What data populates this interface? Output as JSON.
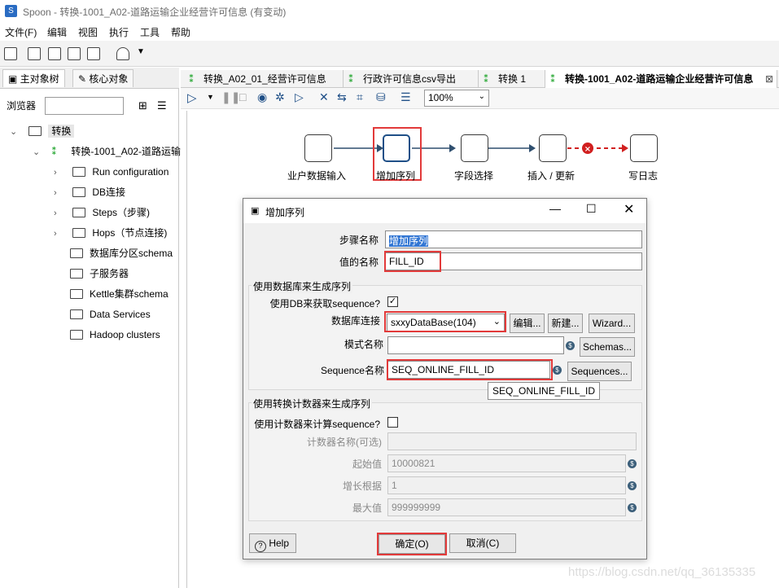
{
  "window": {
    "title": "Spoon - 转换-1001_A02-道路运输企业经营许可信息 (有变动)",
    "logo": "S"
  },
  "menu": [
    "文件(F)",
    "编辑",
    "视图",
    "执行",
    "工具",
    "帮助"
  ],
  "left_panel": {
    "tabs": [
      "主对象树",
      "核心对象"
    ],
    "browse_label": "浏览器",
    "browse_value": "",
    "tree": [
      {
        "label": "转换",
        "level": 0
      },
      {
        "label": "转换-1001_A02-道路运输",
        "level": 1
      },
      {
        "label": "Run configuration",
        "level": 2
      },
      {
        "label": "DB连接",
        "level": 2
      },
      {
        "label": "Steps（步骤)",
        "level": 2
      },
      {
        "label": "Hops（节点连接)",
        "level": 2
      },
      {
        "label": "数据库分区schema",
        "level": 2
      },
      {
        "label": "子服务器",
        "level": 2
      },
      {
        "label": "Kettle集群schema",
        "level": 2
      },
      {
        "label": "Data Services",
        "level": 2
      },
      {
        "label": "Hadoop clusters",
        "level": 2
      }
    ]
  },
  "editor_tabs": [
    {
      "label": "转换_A02_01_经营许可信息",
      "active": false
    },
    {
      "label": "行政许可信息csv导出",
      "active": false
    },
    {
      "label": "转换 1",
      "active": false
    },
    {
      "label": "转换-1001_A02-道路运输企业经营许可信息",
      "active": true
    }
  ],
  "tab_close": "⊠",
  "zoom": "100%",
  "steps": [
    "业户数据输入",
    "增加序列",
    "字段选择",
    "插入 / 更新",
    "写日志"
  ],
  "dialog": {
    "title": "增加序列",
    "step_name_label": "步骤名称",
    "step_name_value": "增加序列",
    "value_name_label": "值的名称",
    "value_name_value": "FILL_ID",
    "db_group_title": "使用数据库来生成序列",
    "use_db_label": "使用DB来获取sequence?",
    "use_db_checked": "✓",
    "db_conn_label": "数据库连接",
    "db_conn_value": "sxxyDataBase(104)",
    "edit_btn": "编辑...",
    "new_btn": "新建...",
    "wizard_btn": "Wizard...",
    "schema_label": "模式名称",
    "schema_value": "",
    "schemas_btn": "Schemas...",
    "seq_label": "Sequence名称",
    "seq_value": "SEQ_ONLINE_FILL_ID",
    "sequences_btn": "Sequences...",
    "tooltip": "SEQ_ONLINE_FILL_ID",
    "counter_group_title": "使用转换计数器来生成序列",
    "use_counter_label": "使用计数器来计算sequence?",
    "counter_name_label": "计数器名称(可选)",
    "counter_name_value": "",
    "start_label": "起始值",
    "start_value": "10000821",
    "increment_label": "增长根据",
    "increment_value": "1",
    "max_label": "最大值",
    "max_value": "999999999",
    "help_btn": "Help",
    "ok_btn": "确定(O)",
    "cancel_btn": "取消(C)"
  },
  "watermark": "https://blog.csdn.net/qq_36135335",
  "colors": {
    "highlight": "#e23a3a",
    "trans_icon": "#2eaa3a",
    "accent": "#2a6cc3"
  }
}
